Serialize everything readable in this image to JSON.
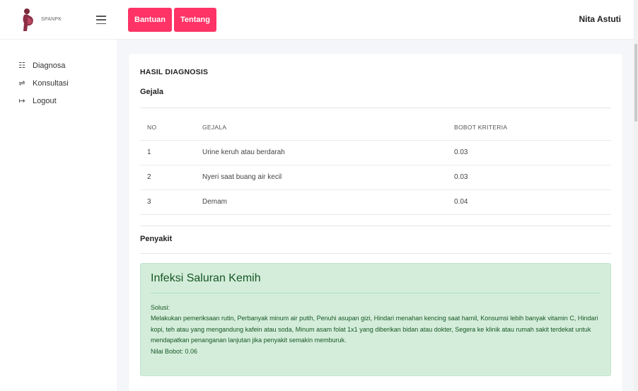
{
  "brand": {
    "name": "SPANPK"
  },
  "sidebar": {
    "items": [
      {
        "icon": "grid-icon",
        "glyph": "☷",
        "label": "Diagnosa"
      },
      {
        "icon": "arrows-icon",
        "glyph": "⇌",
        "label": "Konsultasi"
      },
      {
        "icon": "logout-icon",
        "glyph": "↦",
        "label": "Logout"
      }
    ]
  },
  "topbar": {
    "buttons": [
      "Bantuan",
      "Tentang"
    ],
    "user_name": "Nita Astuti",
    "accent": "#ff3366"
  },
  "main": {
    "title": "HASIL DIAGNOSIS",
    "gejala_title": "Gejala",
    "table": {
      "headers": [
        "NO",
        "GEJALA",
        "BOBOT KRITERIA"
      ],
      "rows": [
        [
          "1",
          "Urine keruh atau berdarah",
          "0.03"
        ],
        [
          "2",
          "Nyeri saat buang air kecil",
          "0.03"
        ],
        [
          "3",
          "Demam",
          "0.04"
        ]
      ]
    },
    "penyakit_title": "Penyakit",
    "result": {
      "disease": "Infeksi Saluran Kemih",
      "solusi_label": "Solusi:",
      "solusi_text": "Melakukan pemeriksaan rutin, Perbanyak minum air putih, Penuhi asupan gizi, Hindari menahan kencing saat hamil, Konsumsi lebih banyak vitamin C, Hindari kopi, teh atau yang mengandung kafein atau soda, Minum asam folat 1x1 yang diberikan bidan atau dokter, Segera ke klinik atau rumah sakit terdekat untuk mendapatkan penanganan lanjutan jika penyakit semakin memburuk.",
      "nilai_bobot": "Nilai Bobot: 0.06",
      "bg_color": "#d4edda",
      "text_color": "#155724"
    }
  }
}
